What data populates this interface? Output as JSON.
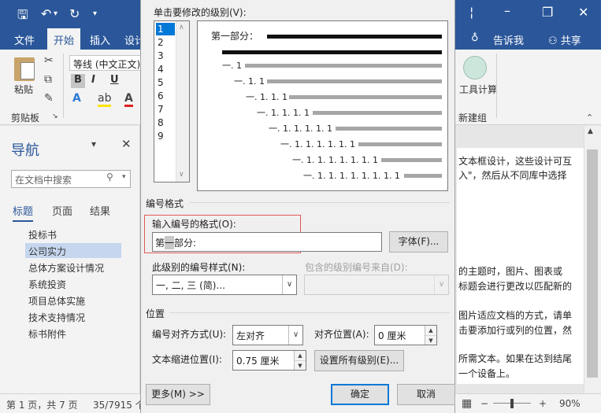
{
  "titlebar": {
    "dropdown_icon": "¦",
    "restore_icon": "❐",
    "close_icon": "✕"
  },
  "ribbon_tabs": {
    "file": "文件",
    "home": "开始",
    "insert": "插入",
    "design_partial": "设计",
    "tellme": "告诉我",
    "share": "共享"
  },
  "ribbon": {
    "paste_label": "粘贴",
    "clipboard_label": "剪贴板",
    "font_name": "等线 (中文正文)",
    "bold": "B",
    "italic": "I",
    "underline": "U",
    "tool_label": "工具计算",
    "new_group_label": "新建组"
  },
  "nav": {
    "title": "导航",
    "search_placeholder": "在文档中搜索",
    "tabs": [
      "标题",
      "页面",
      "结果"
    ],
    "items": [
      "投标书",
      "公司实力",
      "总体方案设计情况",
      "系统投资",
      "项目总体实施",
      "技术支持情况",
      "标书附件"
    ]
  },
  "doc": {
    "lines": [
      "文本框设计，这些设计可互",
      "入\"，然后从不同库中选择",
      "的主题时，图片、图表或",
      "标题会进行更改以匹配新的",
      "图片适应文档的方式，请单",
      "击要添加行或列的位置，然",
      "所需文本。如果在达到结尾",
      "一个设备上。"
    ]
  },
  "statusbar": {
    "page": "第 1 页，共 7 页",
    "words": "35/7915 个",
    "zoom": "90%"
  },
  "dialog": {
    "level_label": "单击要修改的级别(V):",
    "levels": [
      "1",
      "2",
      "3",
      "4",
      "5",
      "6",
      "7",
      "8",
      "9"
    ],
    "selected_level": "1",
    "preview": {
      "level1": "第一部分：",
      "rows": [
        "一. 1",
        "一. 1. 1",
        "一. 1. 1. 1",
        "一. 1. 1. 1. 1",
        "一. 1. 1. 1. 1. 1",
        "一. 1. 1. 1. 1. 1. 1",
        "一. 1. 1. 1. 1. 1. 1. 1",
        "一. 1. 1. 1. 1. 1. 1. 1. 1"
      ]
    },
    "number_format_section": "编号格式",
    "format_input_label": "输入编号的格式(O):",
    "format_value_pre": "第",
    "format_value_sel": "一",
    "format_value_post": "部分:",
    "font_button": "字体(F)...",
    "style_label": "此级别的编号样式(N):",
    "style_value": "一, 二, 三 (简)...",
    "include_label": "包含的级别编号来自(D):",
    "position_section": "位置",
    "align_label": "编号对齐方式(U):",
    "align_value": "左对齐",
    "align_at_label": "对齐位置(A):",
    "align_at_value": "0 厘米",
    "indent_label": "文本缩进位置(I):",
    "indent_value": "0.75 厘米",
    "set_all_button": "设置所有级别(E)...",
    "more_button": "更多(M) >>",
    "ok_button": "确定",
    "cancel_button": "取消"
  }
}
